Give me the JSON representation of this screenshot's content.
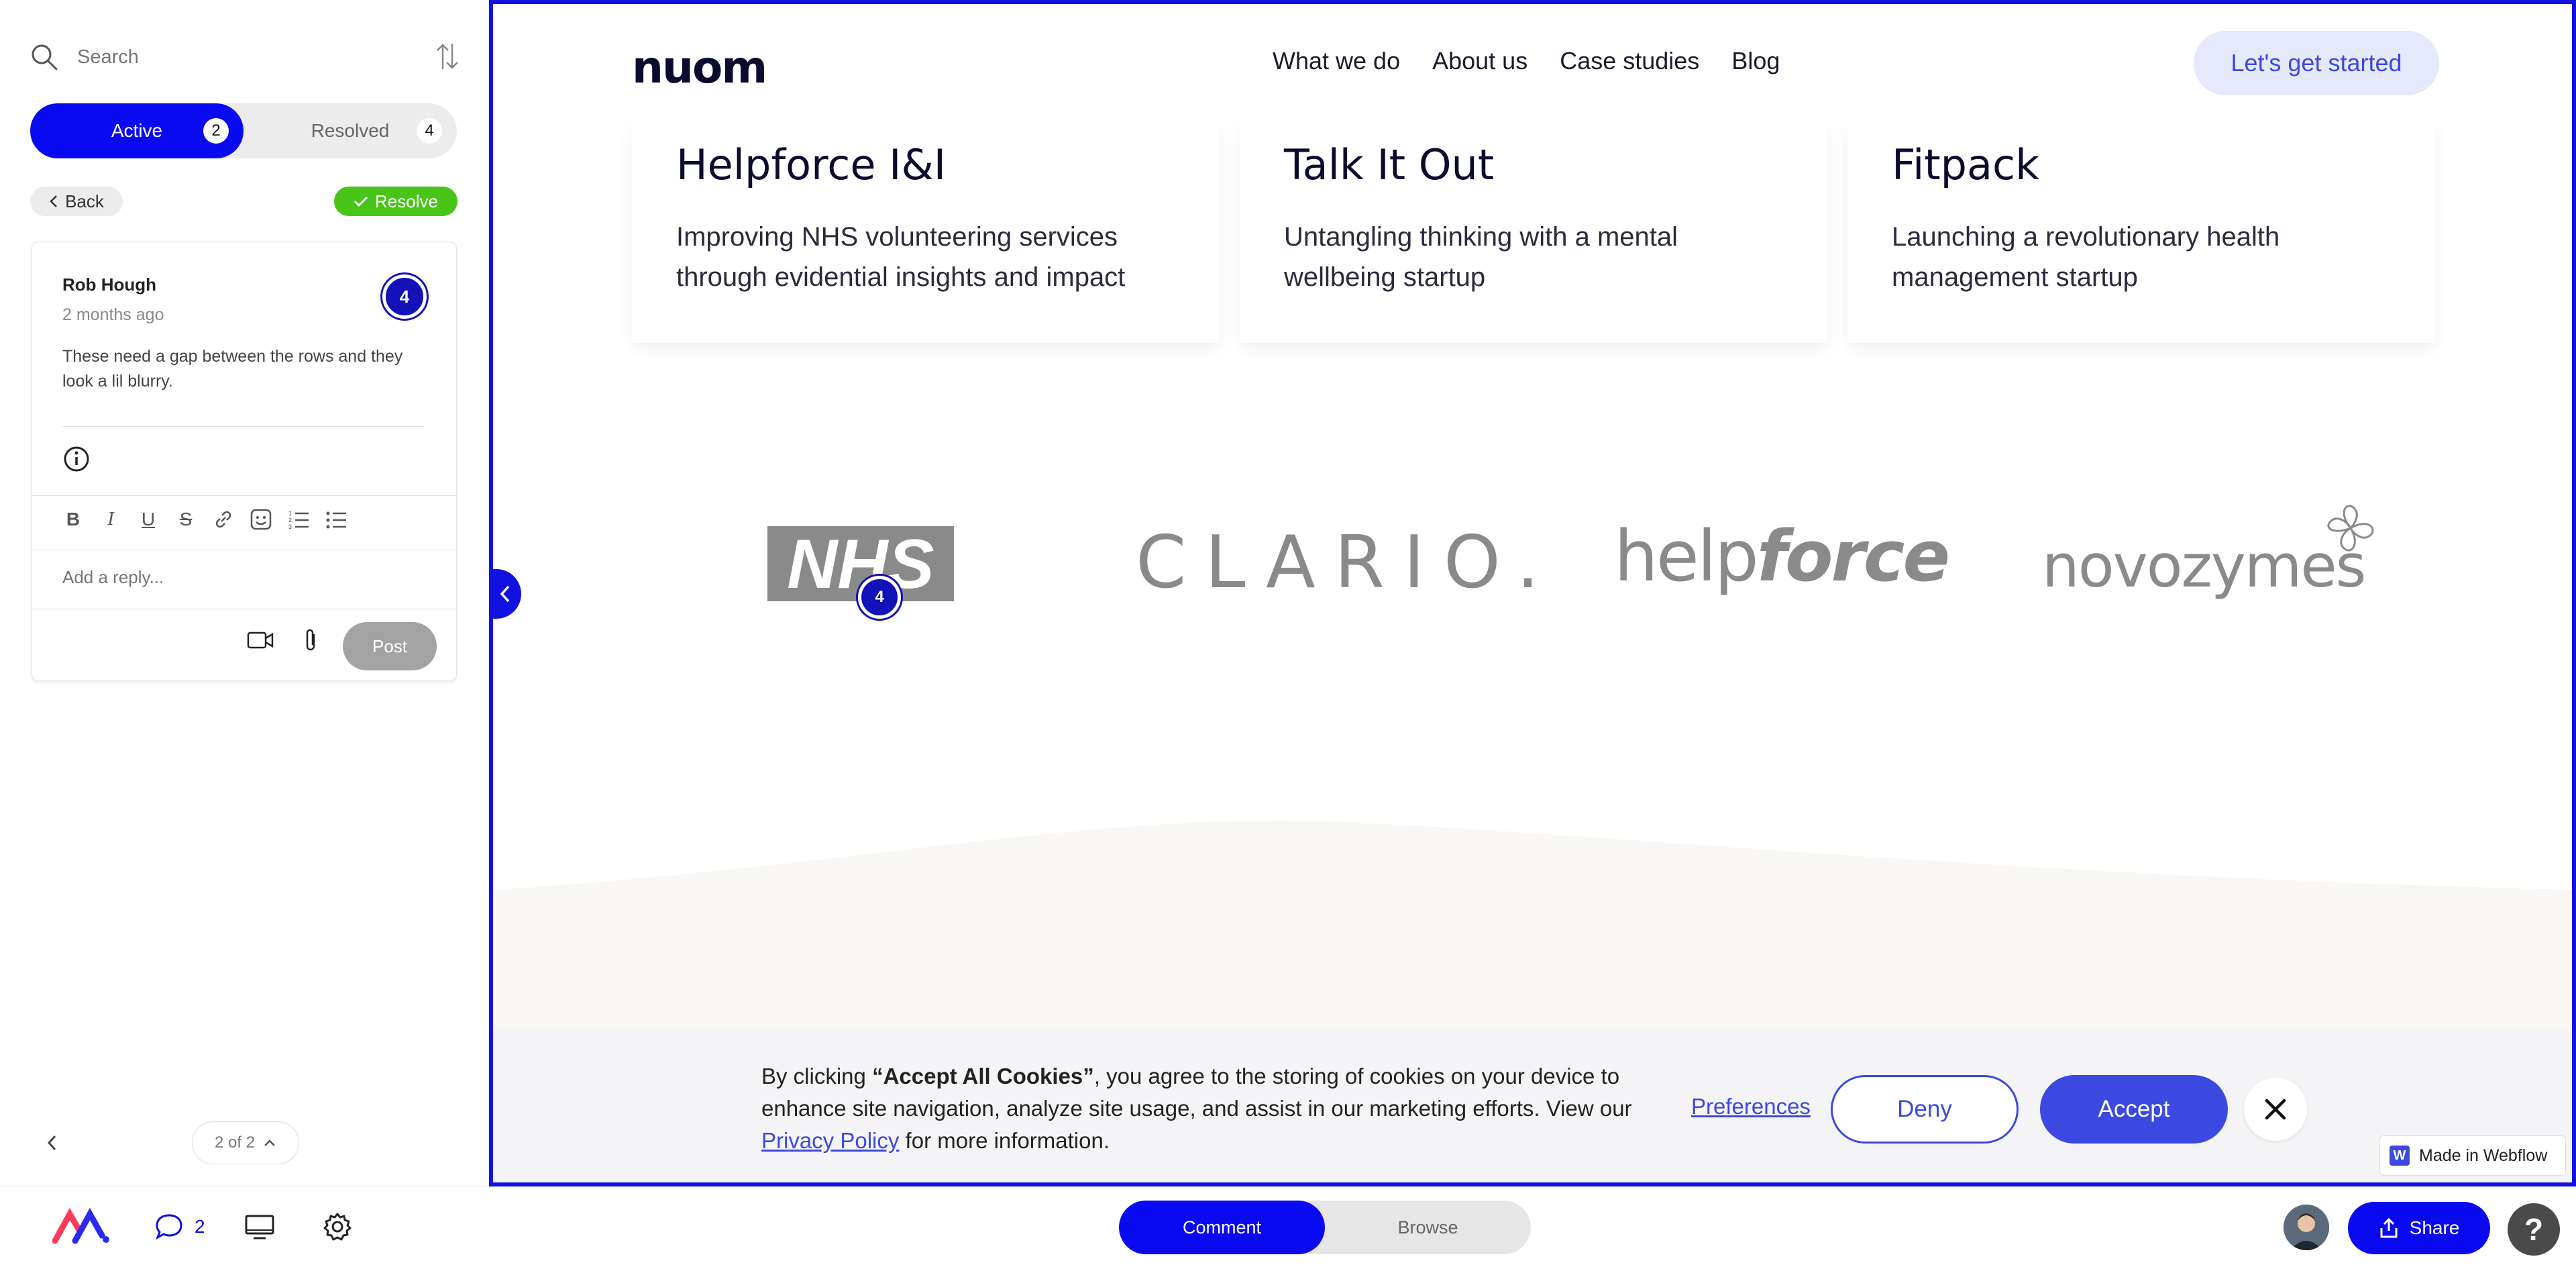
{
  "sidebar": {
    "search_placeholder": "Search",
    "tabs": [
      {
        "label": "Active",
        "count": "2"
      },
      {
        "label": "Resolved",
        "count": "4"
      }
    ],
    "back_label": "Back",
    "resolve_label": "Resolve",
    "comment": {
      "author": "Rob Hough",
      "timestamp": "2 months ago",
      "pin_number": "4",
      "text": "These need a gap between the rows and they look a lil blurry."
    },
    "reply_placeholder": "Add a reply...",
    "post_label": "Post",
    "pager_label": "2 of 2"
  },
  "site": {
    "logo": "nuom",
    "nav": [
      "What we do",
      "About us",
      "Case studies",
      "Blog"
    ],
    "cta_label": "Let's get started",
    "cases": [
      {
        "title": "Helpforce I&I",
        "desc": "Improving NHS volunteering services through evidential insights and impact"
      },
      {
        "title": "Talk It Out",
        "desc": "Untangling thinking with a mental wellbeing startup"
      },
      {
        "title": "Fitpack",
        "desc": "Launching a revolutionary health management startup"
      }
    ],
    "client_logos": {
      "nhs": "NHS",
      "clario": "CLARIO.",
      "helpforce_light": "help",
      "helpforce_bold": "force",
      "novozymes": "novozymes"
    },
    "logo_pin_number": "4",
    "cookie": {
      "text_pre": "By clicking ",
      "text_bold": "“Accept All Cookies”",
      "text_mid": ", you agree to the storing of cookies on your device to enhance site navigation, analyze site usage, and assist in our marketing efforts. View our ",
      "privacy_link": "Privacy Policy",
      "text_post": " for more information.",
      "preferences_label": "Preferences",
      "deny_label": "Deny",
      "accept_label": "Accept"
    },
    "webflow_badge": "Made in Webflow"
  },
  "bottom_bar": {
    "comment_count": "2",
    "modes": [
      "Comment",
      "Browse"
    ],
    "share_label": "Share",
    "help_label": "?"
  },
  "colors": {
    "accent": "#0a0af0",
    "site_accent": "#3b49e0",
    "resolve_green": "#49c51a"
  }
}
